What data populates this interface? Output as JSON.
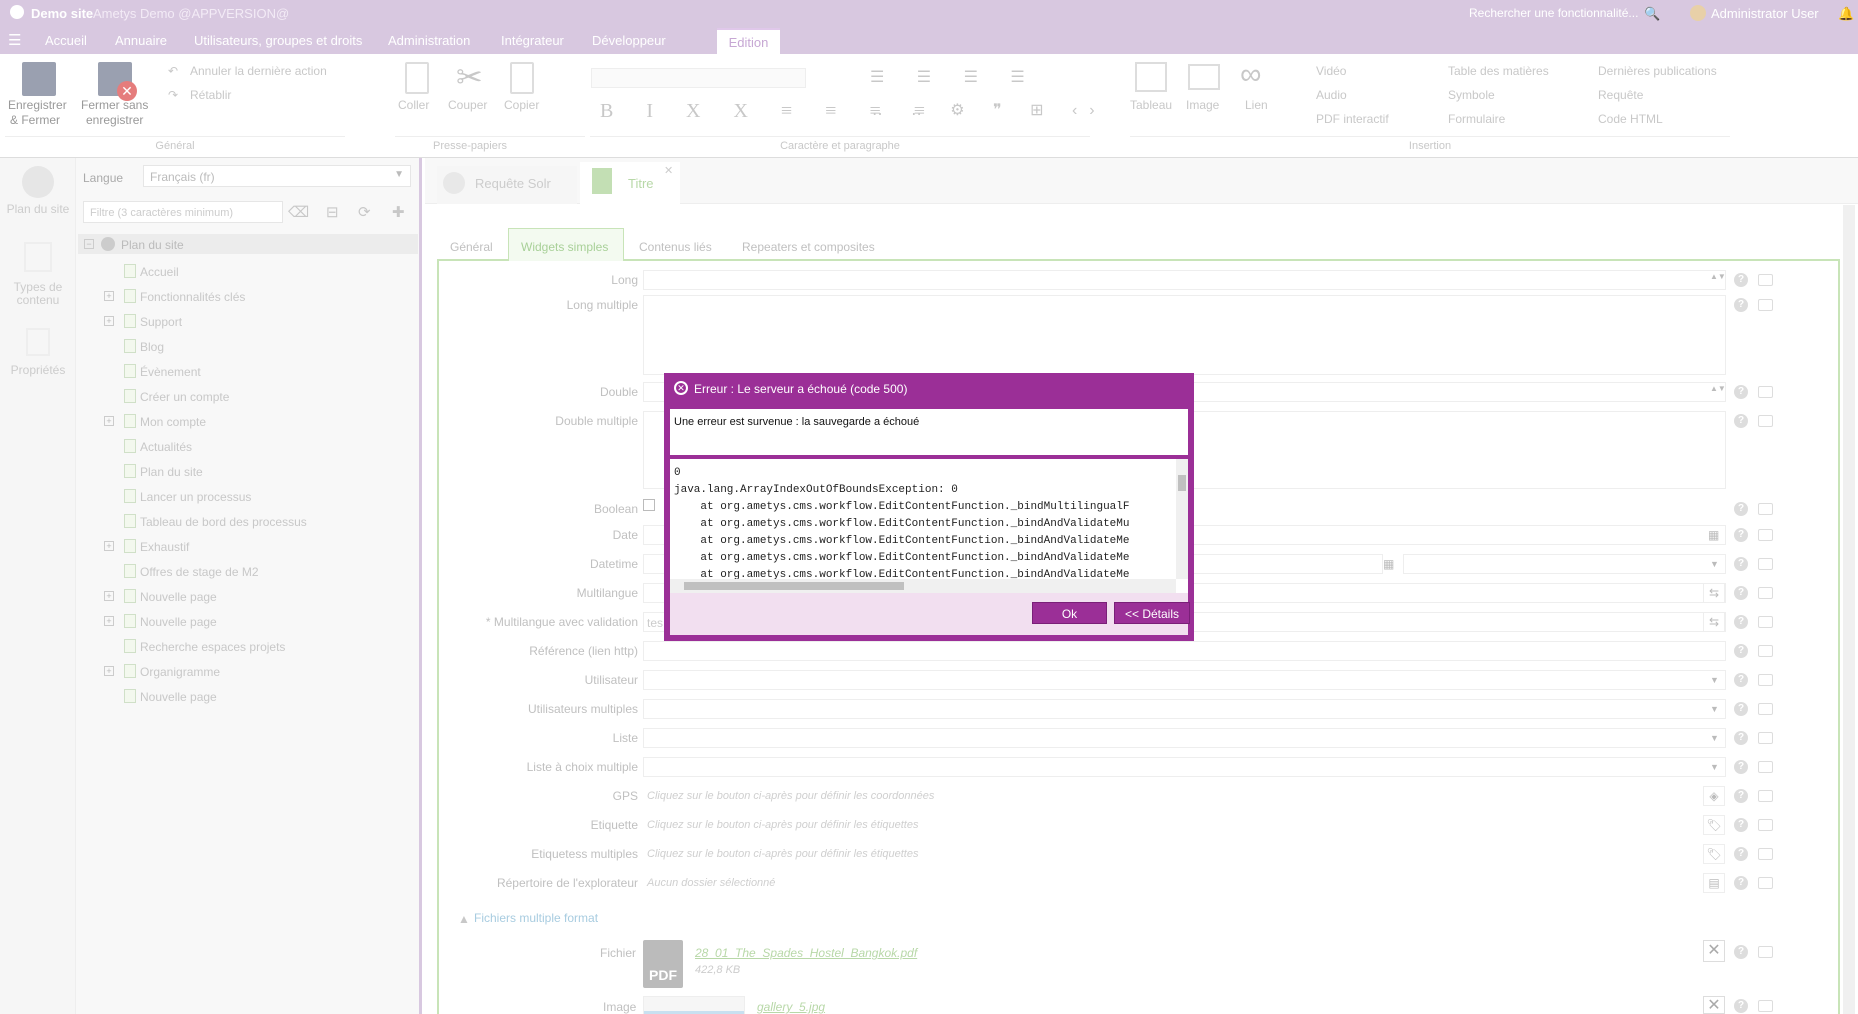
{
  "topbar": {
    "site": "Demo site",
    "app": "Ametys Demo @APPVERSION@",
    "search": "Rechercher une fonctionnalité...",
    "user": "Administrator User"
  },
  "tabs": [
    "Accueil",
    "Annuaire",
    "Utilisateurs, groupes et droits",
    "Administration",
    "Intégrateur",
    "Développeur"
  ],
  "active_tab": "Edition",
  "ribbon": {
    "save_line1": "Enregistrer",
    "save_line2": "& Fermer",
    "close_line1": "Fermer sans",
    "close_line2": "enregistrer",
    "undo": "Annuler la dernière action",
    "redo": "Rétablir",
    "paste": "Coller",
    "cut": "Couper",
    "copy": "Copier",
    "table": "Tableau",
    "image": "Image",
    "link": "Lien",
    "video": "Vidéo",
    "audio": "Audio",
    "pdf": "PDF interactif",
    "toc": "Table des matières",
    "symbol": "Symbole",
    "form": "Formulaire",
    "lastpub": "Dernières publications",
    "query": "Requête",
    "html": "Code HTML",
    "groups": [
      "Général",
      "Presse-papiers",
      "Caractère et paragraphe",
      "Insertion"
    ]
  },
  "leftnav": {
    "sitemap": "Plan du site",
    "types": "Types de contenu",
    "props": "Propriétés"
  },
  "lang": {
    "label": "Langue",
    "value": "Français (fr)"
  },
  "filter_placeholder": "Filtre (3 caractères minimum)",
  "tree": {
    "root": "Plan du site",
    "items": [
      "Accueil",
      "Fonctionnalités clés",
      "Support",
      "Blog",
      "Évènement",
      "Créer un compte",
      "Mon compte",
      "Actualités",
      "Plan du site",
      "Lancer un processus",
      "Tableau de bord des processus",
      "Exhaustif",
      "Offres de stage de M2",
      "Nouvelle page",
      "Nouvelle page",
      "Recherche espaces projets",
      "Organigramme",
      "Nouvelle page"
    ]
  },
  "doctabs": {
    "query": "Requête Solr",
    "title": "Titre"
  },
  "subtabs": [
    "Général",
    "Widgets simples",
    "Contenus liés",
    "Repeaters et composites"
  ],
  "fields": [
    "Long",
    "Long multiple",
    "Double",
    "Double multiple",
    "Boolean",
    "Date",
    "Datetime",
    "Multilangue",
    "* Multilangue avec validation",
    "Référence (lien http)",
    "Utilisateur",
    "Utilisateurs multiples",
    "Liste",
    "Liste à choix multiple",
    "GPS",
    "Etiquette",
    "Etiquetess multiples",
    "Répertoire de l'explorateur"
  ],
  "placeholders": {
    "gps": "Cliquez sur le bouton ci-après pour définir les coordonnées",
    "etiquette": "Cliquez sur le bouton ci-après pour définir les étiquettes",
    "etiquettes": "Cliquez sur le bouton ci-après pour définir les étiquettes",
    "explorer": "Aucun dossier sélectionné"
  },
  "multilang_value": "tes",
  "files": {
    "section": "Fichiers multiple format",
    "file_label": "Fichier",
    "file_name": "28_01_The_Spades_Hostel_Bangkok.pdf",
    "file_size": "422,8 KB",
    "pdf": "PDF",
    "image_label": "Image",
    "image_name": "gallery_5.jpg"
  },
  "dialog": {
    "title": "Erreur : Le serveur a échoué (code 500)",
    "message": "Une erreur est survenue : la sauvegarde a échoué",
    "stack": [
      "0",
      "java.lang.ArrayIndexOutOfBoundsException: 0",
      "    at org.ametys.cms.workflow.EditContentFunction._bindMultilingualF",
      "    at org.ametys.cms.workflow.EditContentFunction._bindAndValidateMu",
      "    at org.ametys.cms.workflow.EditContentFunction._bindAndValidateMe",
      "    at org.ametys.cms.workflow.EditContentFunction._bindAndValidateMe",
      "    at org.ametys.cms.workflow.EditContentFunction._bindAndValidateMe"
    ],
    "ok": "Ok",
    "details": "<< Détails"
  },
  "colors": {
    "purple": "#9b2f97",
    "light_purple": "#d8c8e0"
  }
}
